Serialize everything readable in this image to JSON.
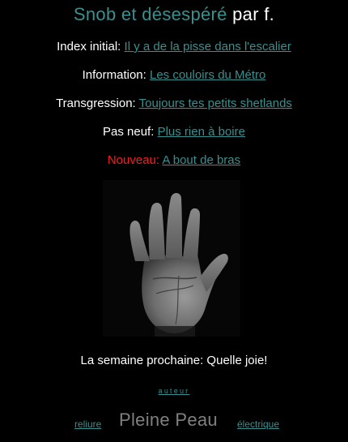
{
  "title": {
    "main": "Snob et désespéré",
    "suffix": "par f."
  },
  "links": [
    {
      "label": "Index initial:",
      "text": "Il y a de la pisse dans l'escalier"
    },
    {
      "label": "Information:",
      "text": "Les couloirs du Métro"
    },
    {
      "label": "Transgression:",
      "text": "Toujours tes petits shetlands"
    },
    {
      "label": "Pas neuf:",
      "text": "Plus rien à boire"
    },
    {
      "label": "Nouveau:",
      "text": "A bout de bras"
    }
  ],
  "next_week": "La semaine prochaine: Quelle joie!",
  "auteur": "auteur",
  "footer": {
    "left": "reliure",
    "center": "Pleine Peau",
    "right": "électrique"
  },
  "colors": {
    "background": "#000000",
    "link": "#3a8f8f",
    "text": "#ffffff",
    "highlight": "#ff1a1a",
    "muted": "#808080"
  }
}
